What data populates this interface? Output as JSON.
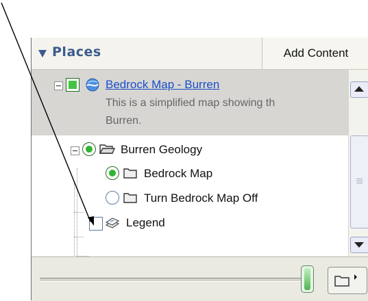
{
  "header": {
    "title": "Places",
    "add_content_label": "Add Content"
  },
  "tree": {
    "items": [
      {
        "label": "Bedrock Map - Burren",
        "control": "checkbox",
        "checked": true,
        "icon": "globe-icon",
        "description_lines": [
          "This is a simplified map showing th",
          "Burren."
        ]
      },
      {
        "label": "Burren Geology",
        "control": "radio",
        "selected": true,
        "icon": "open-folder-icon"
      },
      {
        "label": "Bedrock Map",
        "control": "radio",
        "selected": true,
        "icon": "folder-icon"
      },
      {
        "label": "Turn Bedrock Map Off",
        "control": "radio",
        "selected": false,
        "icon": "folder-icon"
      },
      {
        "label": "Legend",
        "control": "checkbox",
        "checked": false,
        "icon": "layers-icon"
      }
    ]
  },
  "toolbar": {
    "slider_level": 1.0
  },
  "colors": {
    "header_text": "#3b5b8c",
    "link": "#1a4fc9",
    "check_green": "#46c346",
    "selected_row_bg": "#d7d6d3"
  }
}
